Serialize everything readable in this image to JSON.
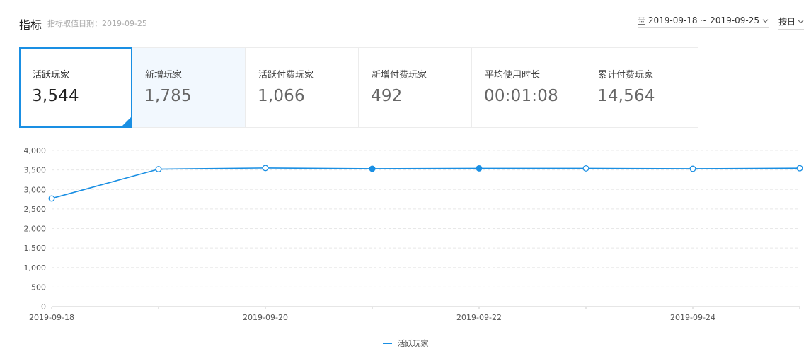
{
  "header": {
    "title": "指标",
    "date_note": "指标取值日期：2019-09-25",
    "date_range": "2019-09-18 ~ 2019-09-25",
    "granularity": "按日"
  },
  "metrics": [
    {
      "label": "活跃玩家",
      "value": "3,544",
      "active": true
    },
    {
      "label": "新增玩家",
      "value": "1,785",
      "hover": true
    },
    {
      "label": "活跃付费玩家",
      "value": "1,066"
    },
    {
      "label": "新增付费玩家",
      "value": "492"
    },
    {
      "label": "平均使用时长",
      "value": "00:01:08"
    },
    {
      "label": "累计付费玩家",
      "value": "14,564"
    }
  ],
  "colors": {
    "accent": "#1a8fe3",
    "grid": "#e8e8e8",
    "axis": "#cccccc"
  },
  "chart_data": {
    "type": "line",
    "x": [
      "2019-09-18",
      "2019-09-19",
      "2019-09-20",
      "2019-09-21",
      "2019-09-22",
      "2019-09-23",
      "2019-09-24",
      "2019-09-25"
    ],
    "x_tick_labels": [
      "2019-09-18",
      "2019-09-20",
      "2019-09-22",
      "2019-09-24"
    ],
    "series": [
      {
        "name": "活跃玩家",
        "values": [
          2770,
          3520,
          3550,
          3530,
          3540,
          3540,
          3530,
          3544
        ],
        "filled_points": [
          3,
          4
        ]
      }
    ],
    "ylim": [
      0,
      4000
    ],
    "y_ticks": [
      0,
      500,
      1000,
      1500,
      2000,
      2500,
      3000,
      3500,
      4000
    ],
    "y_tick_labels": [
      "0",
      "500",
      "1,000",
      "1,500",
      "2,000",
      "2,500",
      "3,000",
      "3,500",
      "4,000"
    ],
    "grid": true,
    "legend": "bottom-center"
  }
}
